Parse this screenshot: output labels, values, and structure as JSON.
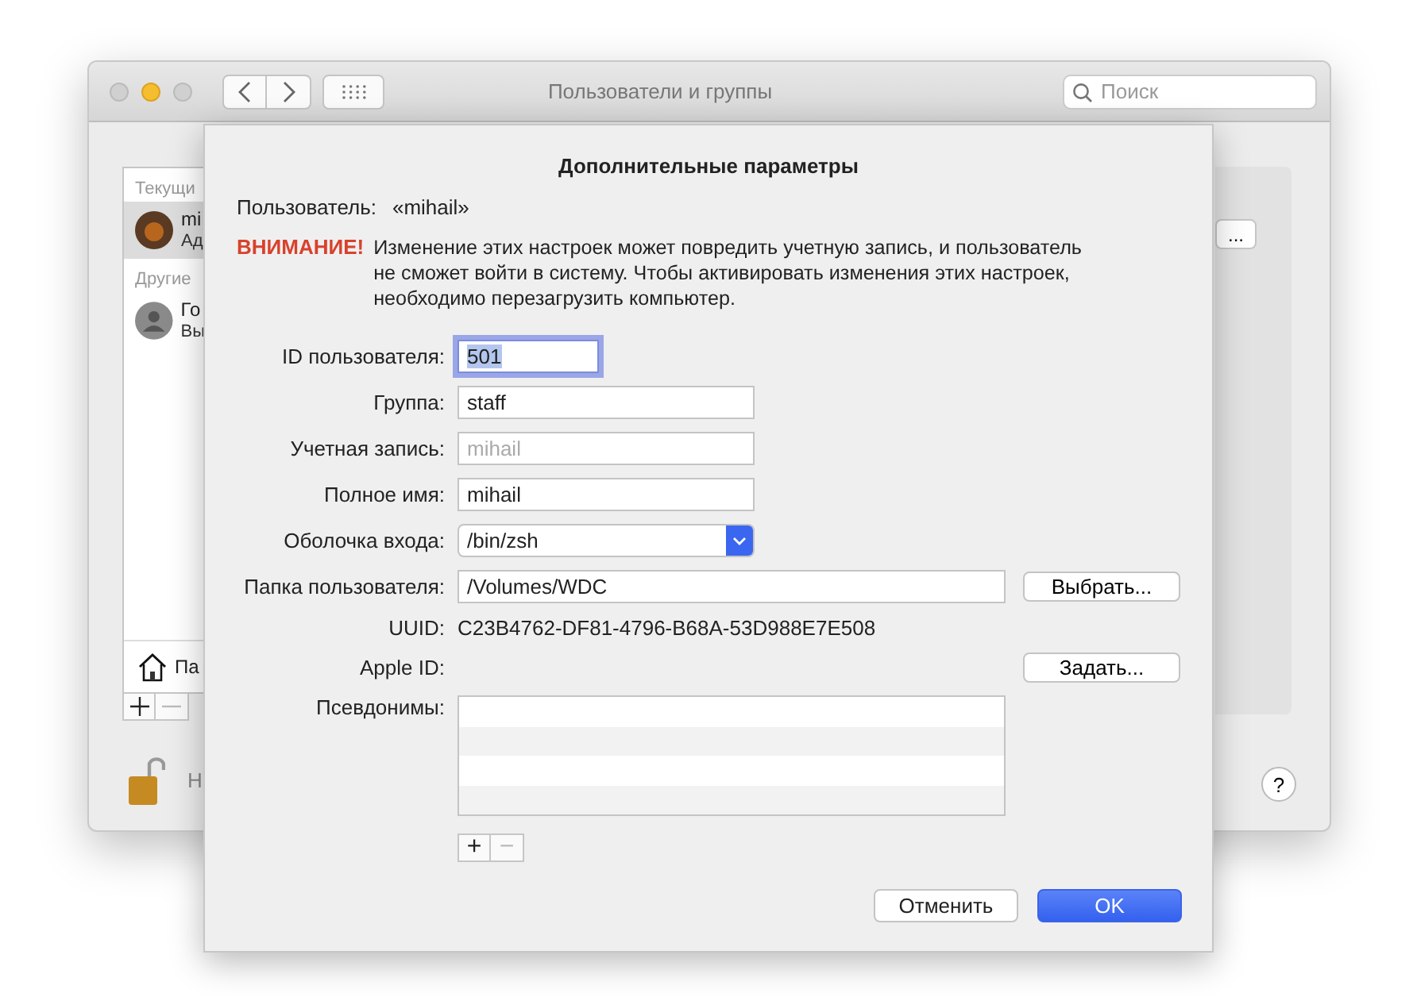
{
  "window": {
    "title": "Пользователи и группы",
    "search": {
      "placeholder": "Поиск"
    },
    "sidebar": {
      "sections": [
        {
          "label": "Текущи",
          "users": [
            {
              "name": "mi",
              "role": "Ад",
              "kind": "photo",
              "selected": true
            }
          ]
        },
        {
          "label": "Другие",
          "users": [
            {
              "name": "Го",
              "role": "Вы",
              "kind": "silhouette",
              "selected": false
            }
          ]
        }
      ],
      "login_options": "Па"
    },
    "right_button": "...",
    "lock_text": "Н",
    "help": "?"
  },
  "sheet": {
    "title": "Дополнительные параметры",
    "user_label": "Пользователь:",
    "user_value": "«mihail»",
    "warning_label": "ВНИМАНИЕ!",
    "warning_text": "Изменение этих настроек может повредить учетную запись, и пользователь не сможет войти в систему. Чтобы активировать изменения этих настроек, необходимо перезагрузить компьютер.",
    "fields": [
      {
        "kind": "text",
        "label": "ID пользователя:",
        "value": "501",
        "focused": true,
        "disabled": false
      },
      {
        "kind": "text",
        "label": "Группа:",
        "value": "staff",
        "focused": false,
        "disabled": false
      },
      {
        "kind": "text",
        "label": "Учетная запись:",
        "value": "mihail",
        "focused": false,
        "disabled": true
      },
      {
        "kind": "text",
        "label": "Полное имя:",
        "value": "mihail",
        "focused": false,
        "disabled": false
      },
      {
        "kind": "popup",
        "label": "Оболочка входа:",
        "value": "/bin/zsh"
      },
      {
        "kind": "text",
        "label": "Папка пользователя:",
        "value": "/Volumes/WDC",
        "focused": false,
        "disabled": false,
        "button": "Выбрать..."
      },
      {
        "kind": "static",
        "label": "UUID:",
        "value": "C23B4762-DF81-4796-B68A-53D988E7E508"
      },
      {
        "kind": "static",
        "label": "Apple ID:",
        "button": "Задать..."
      },
      {
        "kind": "list",
        "label": "Псевдонимы:",
        "add": "+",
        "remove": "−"
      }
    ],
    "buttons": [
      {
        "label": "Отменить",
        "default": false
      },
      {
        "label": "OK",
        "default": true
      }
    ]
  }
}
